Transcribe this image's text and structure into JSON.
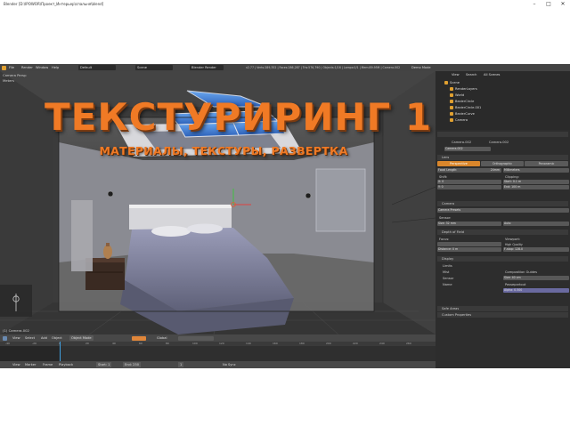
{
  "window": {
    "title": "Blender [D:\\IPOWOR\\Проект_Интерьер\\спальня\\blend]",
    "minimize": "–",
    "maximize": "□",
    "close": "✕"
  },
  "infobar": {
    "menus": [
      "File",
      "Render",
      "Window",
      "Help"
    ],
    "layout": "Default",
    "scene": "Scene",
    "engine": "Blender Render",
    "stats": "v2.77 | Verts:289,352 | Faces:286,287 | Tris:576,790 | Objects:1/16 | Lamps:0/1 | Mem:89.95M | Camera.002",
    "mode": "Demo Mode"
  },
  "viewport": {
    "view_name": "Camera Persp",
    "units": "Meters",
    "object_name": "(1) Camera.002"
  },
  "overlay": {
    "headline": "ТЕКСТУРИРИНГ 1",
    "subline": "МАТЕРИАЛЫ, ТЕКСТУРЫ, РАЗВЕРТКА"
  },
  "viewheader": {
    "items": [
      "View",
      "Select",
      "Add",
      "Object"
    ],
    "mode": "Object Mode",
    "pivot": "Global"
  },
  "outliner": {
    "header": [
      "View",
      "Search",
      "All Scenes"
    ],
    "items": [
      "Scene",
      "RenderLayers",
      "World",
      "BezierCircle",
      "BezierCircle.001",
      "BezierCurve",
      "Camera"
    ]
  },
  "properties": {
    "crumbs": [
      "Camera.002",
      "Camera.002"
    ],
    "datablock": "Camera.002",
    "sections": {
      "lens": "Lens",
      "camera": "Camera",
      "camera_presets": "Camera Presets",
      "depth_of_field": "Depth of Field",
      "display": "Display",
      "safe_areas": "Safe Areas",
      "custom_properties": "Custom Properties"
    },
    "lens_tabs": [
      "Perspective",
      "Orthographic",
      "Panoramic"
    ],
    "focal_length_label": "Focal Length:",
    "focal_length_value": "24mm",
    "lens_unit": "Millimeters",
    "shift_label": "Shift:",
    "shift_x": "X: 0",
    "shift_y": "Y: 0",
    "clipping_label": "Clipping:",
    "clip_start": "Start: 0.1 m",
    "clip_end": "End: 100 m",
    "sensor_label": "Sensor:",
    "sensor_size": "Size: 32 mm",
    "sensor_fit": "Auto",
    "focus_label": "Focus:",
    "distance": "Distance: 0 m",
    "viewport_label": "Viewport:",
    "high_quality": "High Quality",
    "fstop": "F-stop: 128.0",
    "display_items": [
      "Limits",
      "Mist",
      "Sensor",
      "Name"
    ],
    "composition_guides": "Composition Guides",
    "display_size": "Size: 40 cm",
    "passepartout": "Passepartout",
    "alpha": "Alpha: 0.500"
  },
  "timeline": {
    "ticks": [
      "-40",
      "-20",
      "0",
      "20",
      "40",
      "60",
      "80",
      "100",
      "120",
      "140",
      "160",
      "180",
      "200",
      "220",
      "240",
      "260"
    ],
    "header": [
      "View",
      "Marker",
      "Frame",
      "Playback"
    ],
    "start": "Start: 1",
    "end": "End: 250",
    "current": "1",
    "sync": "No Sync"
  }
}
